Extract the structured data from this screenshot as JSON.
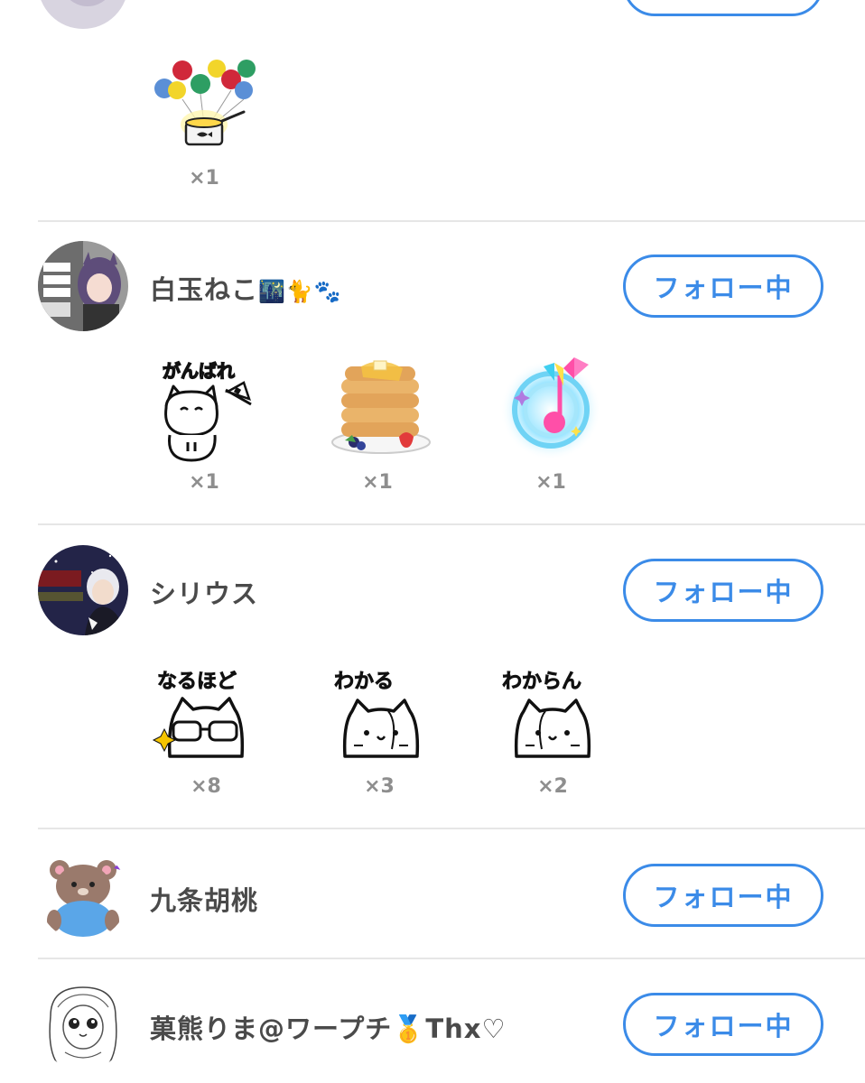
{
  "colors": {
    "accent": "#3b8be8",
    "divider": "#e6e6e6",
    "count": "#8e8e8e"
  },
  "follow_label": "フォロー中",
  "top_partial": {
    "stickers": [
      {
        "icon": "balloon-pot-sticker",
        "count": "×1"
      }
    ]
  },
  "users": [
    {
      "name": "白玉ねこ",
      "name_emoji": "🌃🐈🐾",
      "stickers": [
        {
          "icon": "ganbare-cat-sticker",
          "caption": "がんばれ",
          "count": "×1"
        },
        {
          "icon": "pancake-sticker",
          "count": "×1"
        },
        {
          "icon": "music-note-sticker",
          "count": "×1"
        }
      ]
    },
    {
      "name": "シリウス",
      "stickers": [
        {
          "icon": "naruhodo-cat-sticker",
          "caption": "なるほど",
          "count": "×8"
        },
        {
          "icon": "wakaru-cat-sticker",
          "caption": "わかる",
          "count": "×3"
        },
        {
          "icon": "wakaran-cat-sticker",
          "caption": "わからん",
          "count": "×2"
        }
      ]
    },
    {
      "name": "九条胡桃"
    },
    {
      "name": "菓熊りま@ワープチ🥇Thx♡"
    }
  ]
}
